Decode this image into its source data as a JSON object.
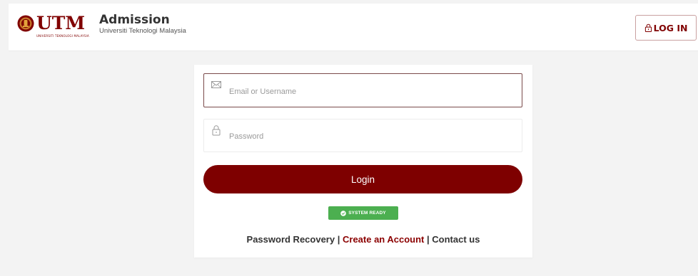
{
  "header": {
    "logo_word": "UTM",
    "logo_subtext": "UNIVERSITI TEKNOLOGI MALAYSIA",
    "title": "Admission",
    "subtitle": "Universiti Teknologi Malaysia",
    "login_label": "LOG IN"
  },
  "form": {
    "email_placeholder": "Email or Username",
    "password_placeholder": "Password",
    "submit_label": "Login",
    "status_label": "SYSTEM READY"
  },
  "links": {
    "recovery": "Password Recovery",
    "create_account": "Create an Account",
    "contact": "Contact us",
    "separator": "|"
  },
  "colors": {
    "brand": "#800000",
    "status": "#4caf50",
    "background": "#f3f3f3"
  },
  "icons": {
    "seal": "utm-seal-icon",
    "login": "lock-icon",
    "email": "envelope-icon",
    "password": "lock-icon",
    "status": "check-circle-icon"
  }
}
